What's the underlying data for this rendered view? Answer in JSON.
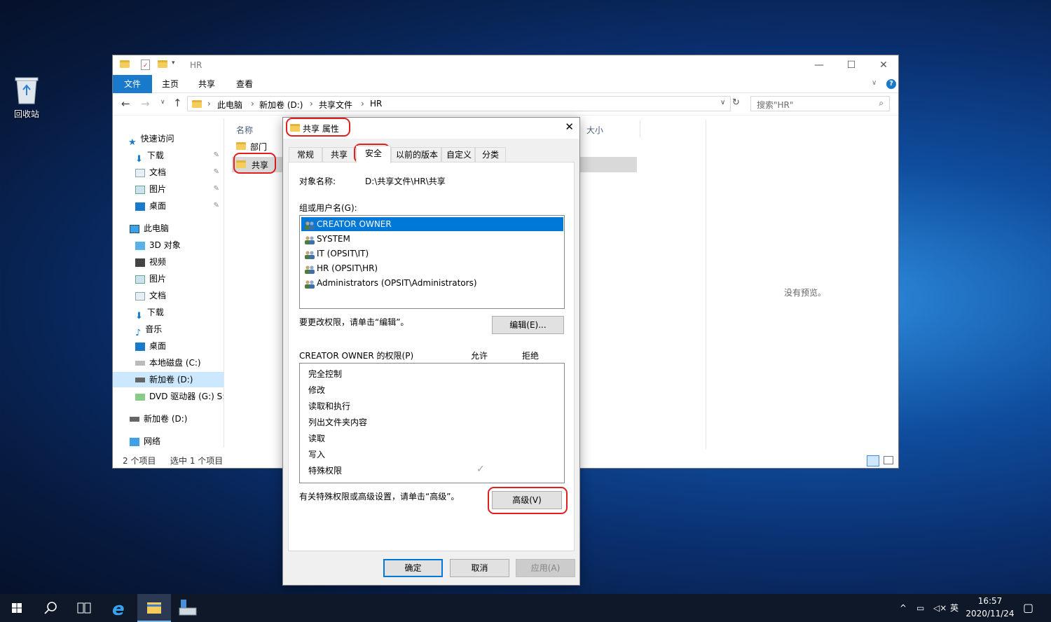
{
  "desktop": {
    "recycle_bin_label": "回收站"
  },
  "explorer": {
    "title": "HR",
    "ribbon_tabs": [
      "文件",
      "主页",
      "共享",
      "查看"
    ],
    "breadcrumb": [
      "此电脑",
      "新加卷 (D:)",
      "共享文件",
      "HR"
    ],
    "search_placeholder": "搜索\"HR\"",
    "column_name": "名称",
    "column_size": "大小",
    "files": [
      "部门",
      "共享"
    ],
    "nav": {
      "quick_access": "快速访问",
      "qa_items": [
        "下载",
        "文档",
        "图片",
        "桌面"
      ],
      "this_pc": "此电脑",
      "pc_items": [
        "3D 对象",
        "视频",
        "图片",
        "文档",
        "下载",
        "音乐",
        "桌面",
        "本地磁盘 (C:)",
        "新加卷 (D:)",
        "DVD 驱动器 (G:) S:"
      ],
      "drive_d": "新加卷 (D:)",
      "network": "网络"
    },
    "status_count": "2 个项目",
    "status_selected": "选中 1 个项目",
    "preview_text": "没有预览。"
  },
  "dialog": {
    "title": "共享 属性",
    "tabs": [
      "常规",
      "共享",
      "安全",
      "以前的版本",
      "自定义",
      "分类"
    ],
    "object_label": "对象名称:",
    "object_value": "D:\\共享文件\\HR\\共享",
    "group_label": "组或用户名(G):",
    "users": [
      "CREATOR OWNER",
      "SYSTEM",
      "IT (OPSIT\\IT)",
      "HR (OPSIT\\HR)",
      "Administrators (OPSIT\\Administrators)"
    ],
    "change_hint": "要更改权限，请单击“编辑”。",
    "edit_button": "编辑(E)...",
    "perm_label": "CREATOR OWNER 的权限(P)",
    "allow": "允许",
    "deny": "拒绝",
    "permissions": [
      "完全控制",
      "修改",
      "读取和执行",
      "列出文件夹内容",
      "读取",
      "写入",
      "特殊权限"
    ],
    "checkmark": "✓",
    "advanced_hint": "有关特殊权限或高级设置，请单击“高级”。",
    "advanced_button": "高级(V)",
    "ok": "确定",
    "cancel": "取消",
    "apply": "应用(A)"
  },
  "taskbar": {
    "lang": "英",
    "time": "16:57",
    "date": "2020/11/24"
  }
}
